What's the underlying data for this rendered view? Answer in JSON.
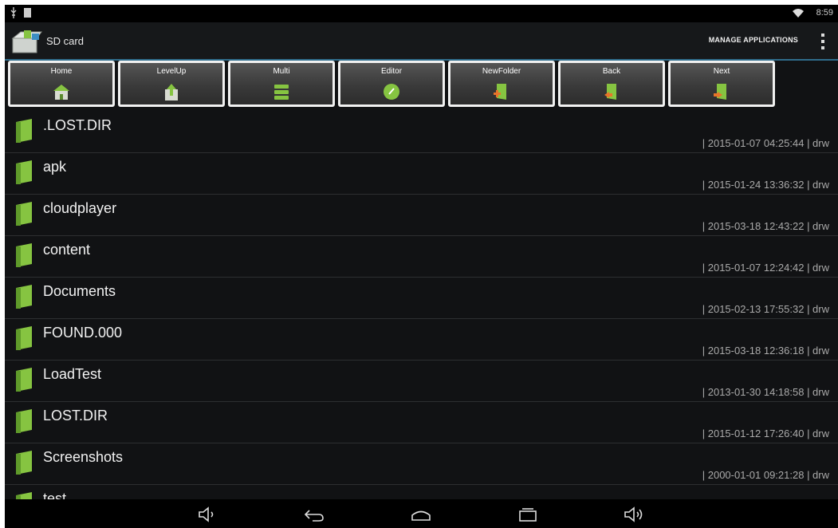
{
  "status_bar": {
    "time": "8:59",
    "left_icons": [
      "usb-icon",
      "notification-icon"
    ],
    "right_icons": [
      "wifi-icon"
    ]
  },
  "action_bar": {
    "title": "SD card",
    "manage_label": "MANAGE APPLICATIONS",
    "app_icon": "package-icon"
  },
  "toolbar": {
    "buttons": [
      {
        "label": "Home",
        "icon": "home-icon"
      },
      {
        "label": "LevelUp",
        "icon": "level-up-icon"
      },
      {
        "label": "Multi",
        "icon": "multi-select-icon"
      },
      {
        "label": "Editor",
        "icon": "editor-icon"
      },
      {
        "label": "NewFolder",
        "icon": "new-folder-icon"
      },
      {
        "label": "Back",
        "icon": "back-icon"
      },
      {
        "label": "Next",
        "icon": "next-icon"
      }
    ]
  },
  "files": [
    {
      "name": ".LOST.DIR",
      "meta": "| 2015-01-07 04:25:44 | drw"
    },
    {
      "name": "apk",
      "meta": "| 2015-01-24 13:36:32 | drw"
    },
    {
      "name": "cloudplayer",
      "meta": "| 2015-03-18 12:43:22 | drw"
    },
    {
      "name": "content",
      "meta": "| 2015-01-07 12:24:42 | drw"
    },
    {
      "name": "Documents",
      "meta": "| 2015-02-13 17:55:32 | drw"
    },
    {
      "name": "FOUND.000",
      "meta": "| 2015-03-18 12:36:18 | drw"
    },
    {
      "name": "LoadTest",
      "meta": "| 2013-01-30 14:18:58 | drw"
    },
    {
      "name": "LOST.DIR",
      "meta": "| 2015-01-12 17:26:40 | drw"
    },
    {
      "name": "Screenshots",
      "meta": "| 2000-01-01 09:21:28 | drw"
    },
    {
      "name": "test",
      "meta": ""
    }
  ],
  "nav_bar": {
    "icons": [
      "volume-down-icon",
      "back-nav-icon",
      "home-nav-icon",
      "recents-icon",
      "volume-up-icon"
    ]
  },
  "colors": {
    "background": "#111214",
    "accent": "#2f6d8c",
    "folder_green": "#86c441",
    "toolbar_border": "#f1f1f1"
  }
}
